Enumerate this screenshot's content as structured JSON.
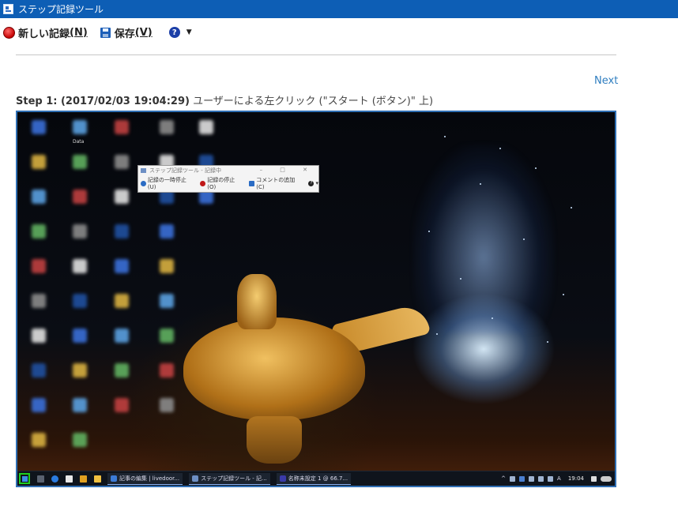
{
  "window": {
    "title": "ステップ記録ツール"
  },
  "toolbar": {
    "new_recording_label": "新しい記録",
    "new_recording_key": "(N)",
    "save_label": "保存",
    "save_key": "(V)",
    "help_glyph": "?",
    "dropdown_glyph": "▼"
  },
  "nav": {
    "next_label": "Next"
  },
  "step": {
    "prefix": "Step 1: (2017/02/03 19:04:29)",
    "description": " ユーザーによる左クリック (\"スタート (ボタン)\" 上)"
  },
  "screenshot": {
    "desktop_label": "Data",
    "mini_window": {
      "title": "ステップ記録ツール - 記録中",
      "controls": "–  □  ✕",
      "pause_label": "記録の一時停止(U)",
      "stop_label": "記録の停止(O)",
      "comment_label": "コメントの追加(C)",
      "help_glyph": "?",
      "dropdown_glyph": "▾"
    },
    "taskbar": {
      "tasks": [
        "記事の編集 | livedoor...",
        "ステップ記録ツール - 記...",
        "名称未設定 1 @ 66.7..."
      ],
      "tray_glyph": "^",
      "ime": "A",
      "clock": "19:04"
    }
  },
  "colors": {
    "titlebar": "#0d5eb5",
    "link": "#2f7ec0",
    "frame": "#2f6fb4",
    "start_highlight": "#1fd01f"
  },
  "icons": {
    "app": "steps-recorder-icon",
    "record": "record-icon",
    "save": "save-disk-icon",
    "help": "help-icon",
    "start": "windows-start-icon"
  }
}
